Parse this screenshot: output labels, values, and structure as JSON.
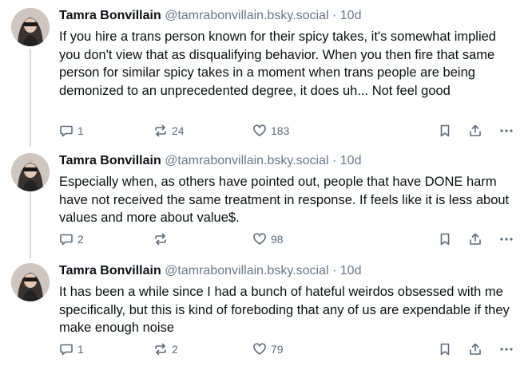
{
  "posts": [
    {
      "author_name": "Tamra Bonvillain",
      "handle": "@tamrabonvillain.bsky.social",
      "separator": "·",
      "time": "10d",
      "text": "If you hire a trans person known for their spicy takes, it's somewhat implied you don't view that as disqualifying behavior. When you then fire that same person for similar spicy takes in a moment when trans people are being demonized to an unprecedented degree, it does uh... Not feel good",
      "replies": "1",
      "reposts": "24",
      "likes": "183"
    },
    {
      "author_name": "Tamra Bonvillain",
      "handle": "@tamrabonvillain.bsky.social",
      "separator": "·",
      "time": "10d",
      "text": "Especially when, as others have pointed out, people that have DONE harm have not received the same treatment in response. If feels like it is less about values and more about value$.",
      "replies": "2",
      "reposts": "",
      "likes": "98"
    },
    {
      "author_name": "Tamra Bonvillain",
      "handle": "@tamrabonvillain.bsky.social",
      "separator": "·",
      "time": "10d",
      "text": "It has been a while since I had a bunch of hateful weirdos obsessed with me specifically, but this is kind of foreboding that any of us are expendable if they make enough noise",
      "replies": "1",
      "reposts": "2",
      "likes": "79"
    }
  ],
  "icons": {
    "reply": "speech-bubble-icon",
    "repost": "repost-arrows-icon",
    "like": "heart-icon",
    "bookmark": "bookmark-icon",
    "share": "share-icon",
    "more": "ellipsis-icon"
  },
  "colors": {
    "text": "#0b0f14",
    "muted": "#68788a",
    "icon": "#5b6b7c",
    "thread_line": "#d4dbe2"
  }
}
